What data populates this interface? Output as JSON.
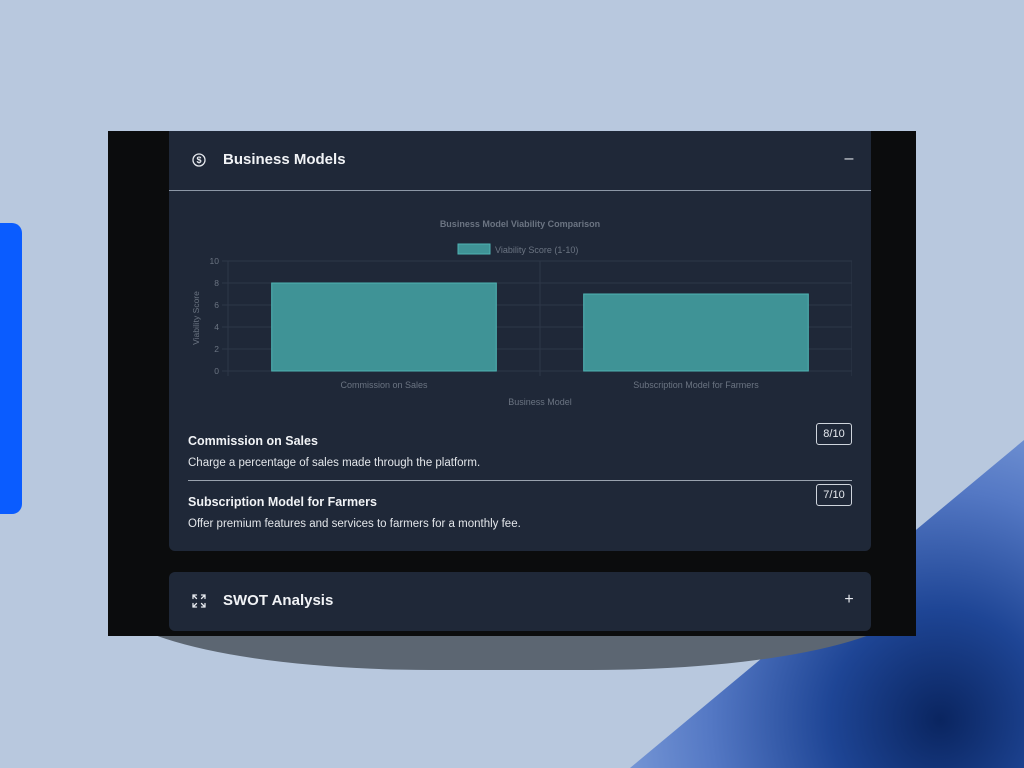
{
  "sections": {
    "business_models": {
      "title": "Business Models",
      "toggle": "–",
      "icon": "dollar-circle-icon"
    },
    "swot": {
      "title": "SWOT Analysis",
      "toggle": "+",
      "icon": "expand-arrows-icon"
    }
  },
  "models": [
    {
      "name": "Commission on Sales",
      "description": "Charge a percentage of sales made through the platform.",
      "score": "8/10"
    },
    {
      "name": "Subscription Model for Farmers",
      "description": "Offer premium features and services to farmers for a monthly fee.",
      "score": "7/10"
    }
  ],
  "chart_data": {
    "type": "bar",
    "title": "Business Model Viability Comparison",
    "xlabel": "Business Model",
    "ylabel": "Viability Score",
    "categories": [
      "Commission on Sales",
      "Subscription Model for Farmers"
    ],
    "series": [
      {
        "name": "Viability Score (1-10)",
        "values": [
          8,
          7
        ]
      }
    ],
    "ylim": [
      0,
      10
    ],
    "yticks": [
      0,
      2,
      4,
      6,
      8,
      10
    ],
    "grid": true,
    "legend": "top-center",
    "colors": {
      "bar": "#3f9396",
      "bar_border": "#4fb3b3"
    }
  },
  "colors": {
    "panel": "#1f2838",
    "window": "#0b0c0d",
    "accent_tab": "#0a5cff"
  }
}
